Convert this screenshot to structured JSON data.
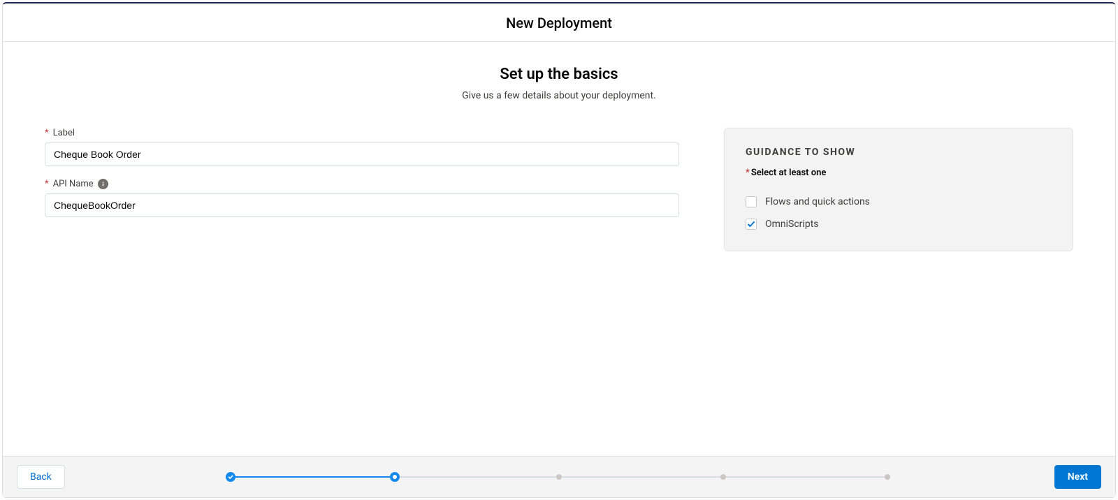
{
  "header": {
    "title": "New Deployment"
  },
  "section": {
    "heading": "Set up the basics",
    "sub": "Give us a few details about your deployment."
  },
  "form": {
    "label_field": {
      "label": "Label",
      "value": "Cheque Book Order"
    },
    "api_name_field": {
      "label": "API Name",
      "value": "ChequeBookOrder"
    }
  },
  "guidance": {
    "title": "GUIDANCE TO SHOW",
    "select_hint": "Select at least one",
    "options": {
      "flows": {
        "label": "Flows and quick actions",
        "checked": false
      },
      "omniscripts": {
        "label": "OmniScripts",
        "checked": true
      }
    }
  },
  "footer": {
    "back": "Back",
    "next": "Next",
    "progress": {
      "total_steps": 5,
      "completed": 1,
      "current_index": 1
    }
  }
}
